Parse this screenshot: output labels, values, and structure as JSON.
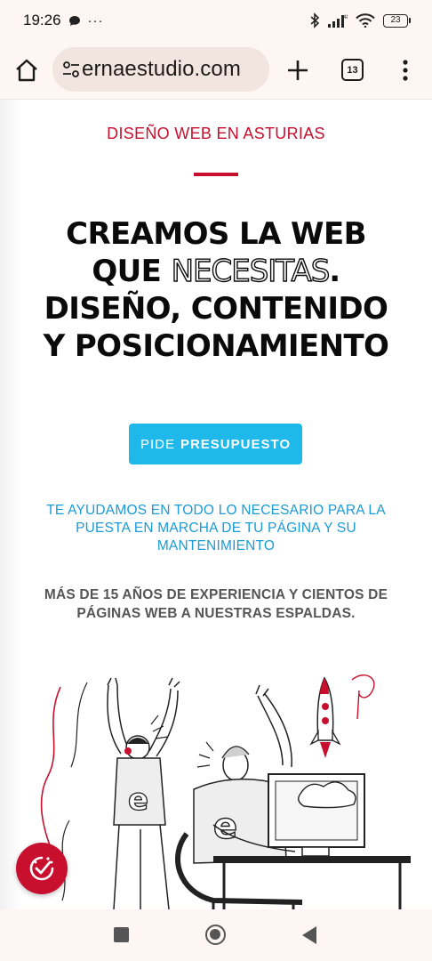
{
  "status_bar": {
    "time": "19:26",
    "notif_more": "···",
    "battery": "23"
  },
  "browser": {
    "url": "ernaestudio.com",
    "tab_count": "13"
  },
  "page": {
    "kicker": "DISEÑO WEB EN ASTURIAS",
    "headline_line1": "CREAMOS LA WEB",
    "headline_que": "QUE ",
    "headline_outlined": "NECESITAS",
    "headline_dot": ".",
    "headline_line3": "DISEÑO, CONTENIDO",
    "headline_line4": "Y POSICIONAMIENTO",
    "cta_light": "PIDE",
    "cta_bold": "PRESUPUESTO",
    "blue_paragraph": "TE AYUDAMOS EN TODO LO NECESARIO PARA LA PUESTA EN MARCHA DE TU PÁGINA Y SU MANTENIMIENTO",
    "grey_paragraph": "MÁS DE 15 AÑOS DE EXPERIENCIA Y CIENTOS DE PÁGINAS WEB A NUESTRAS ESPALDAS."
  },
  "icons": {
    "home": "home-icon",
    "site_settings": "site-settings-icon",
    "new_tab": "plus-icon",
    "tabs": "tabs-icon",
    "menu": "more-vert-icon",
    "badge": "cookie-consent-icon",
    "nav_recents": "recents-icon",
    "nav_home": "home-circle-icon",
    "nav_back": "back-icon"
  },
  "colors": {
    "brand_red": "#c8102e",
    "cta_blue": "#1fb8ea",
    "text_blue": "#1a9ad6",
    "browser_bg": "#fdf6f3"
  }
}
